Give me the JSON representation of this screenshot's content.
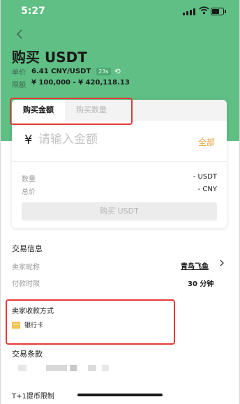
{
  "status_bar": {
    "time": "5:27"
  },
  "header": {
    "title": "购买 USDT",
    "unit_price_label": "单价",
    "unit_price": "6.41 CNY/USDT",
    "countdown": "23s",
    "limit_label": "限额",
    "limit_range": "¥ 100,000 - ¥ 420,118.13"
  },
  "tabs": [
    {
      "label": "购买金额",
      "active": true
    },
    {
      "label": "购买数量",
      "active": false
    }
  ],
  "amount_input": {
    "currency_symbol": "¥",
    "placeholder": "请输入金额",
    "all_label": "全部"
  },
  "summary": {
    "quantity_label": "数量",
    "quantity_value": "- USDT",
    "total_label": "总价",
    "total_value": "- CNY"
  },
  "buy_button": {
    "label": "购买 USDT",
    "enabled": false
  },
  "trade_info": {
    "title": "交易信息",
    "seller_label": "卖家昵称",
    "seller_name": "青鸟飞鱼",
    "pay_time_label": "付款时限",
    "pay_time_value": "30 分钟"
  },
  "payment_methods": {
    "title": "卖家收款方式",
    "items": [
      {
        "icon": "bank-card-icon",
        "label": "银行卡"
      }
    ]
  },
  "terms": {
    "title": "交易条款"
  },
  "withdraw_limit": {
    "title": "T+1提币限制"
  },
  "colors": {
    "header_green": "#5fbf84",
    "accent_orange": "#e8a13b",
    "highlight_red": "#e53935"
  }
}
